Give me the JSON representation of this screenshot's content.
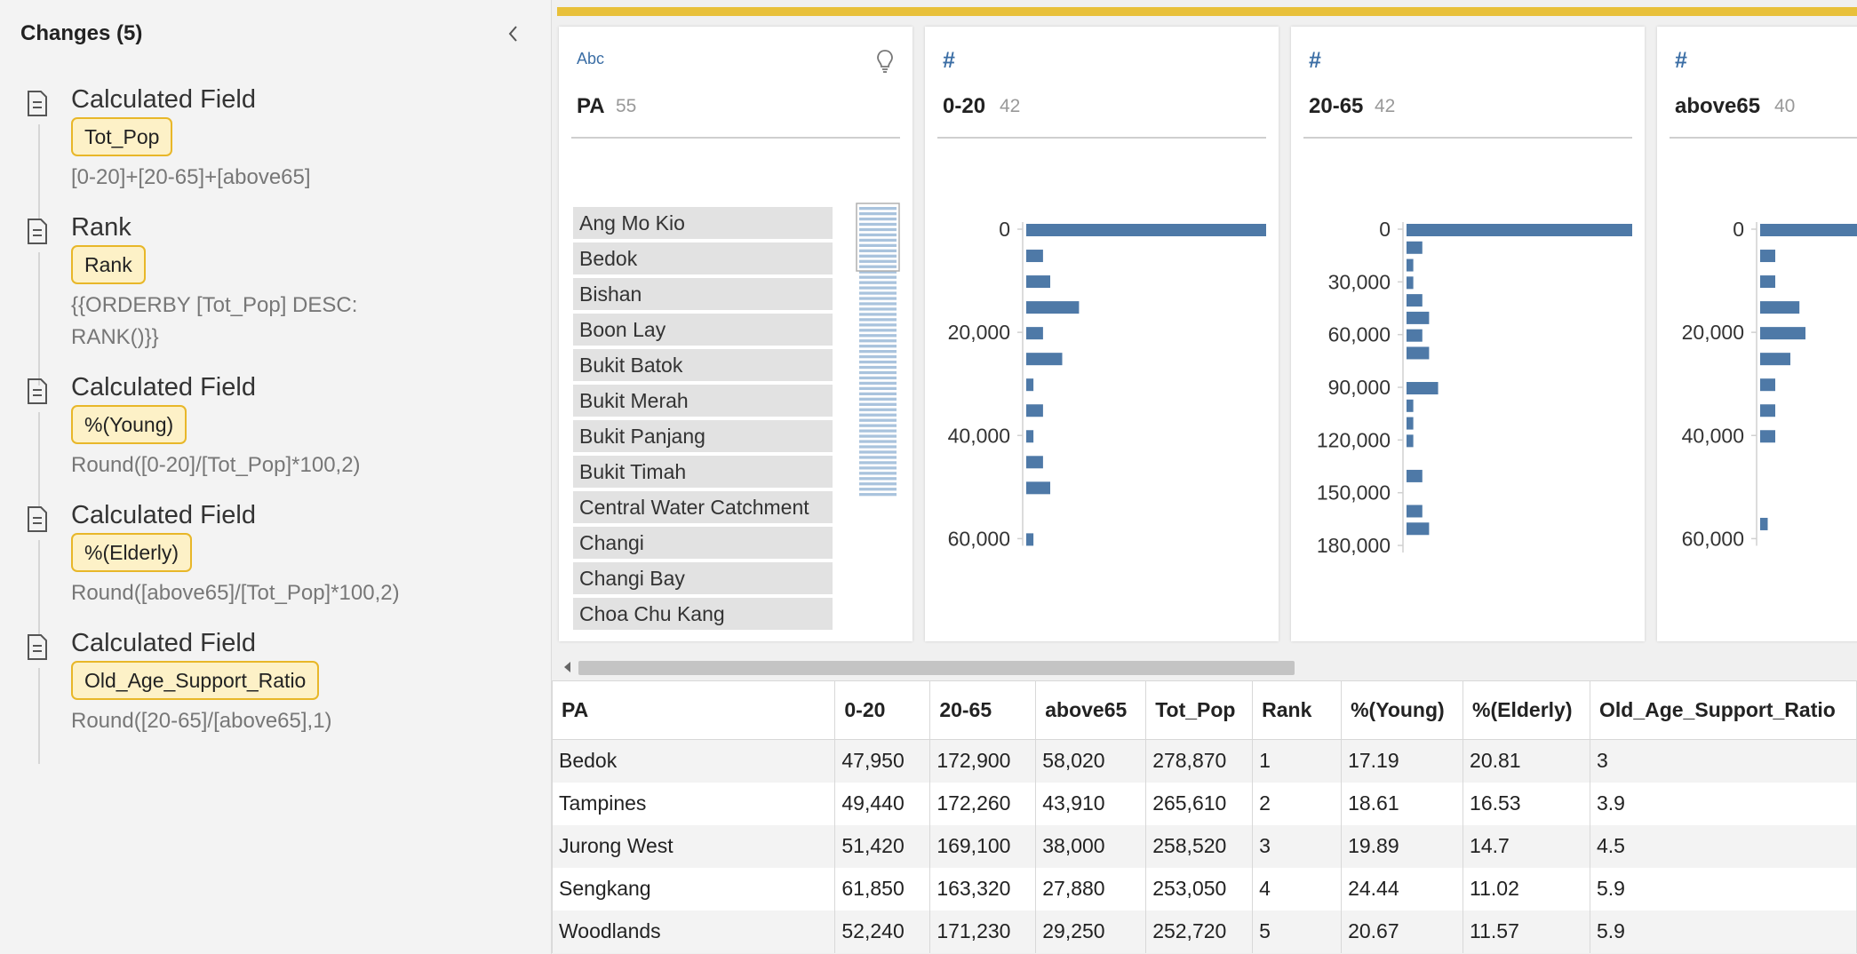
{
  "changes_panel": {
    "title": "Changes (5)",
    "items": [
      {
        "type": "Calculated Field",
        "field": "Tot_Pop",
        "formula": "[0-20]+[20-65]+[above65]"
      },
      {
        "type": "Rank",
        "field": "Rank",
        "formula": "{{ORDERBY [Tot_Pop] DESC:\nRANK()}}"
      },
      {
        "type": "Calculated Field",
        "field": "%(Young)",
        "formula": "Round([0-20]/[Tot_Pop]*100,2)"
      },
      {
        "type": "Calculated Field",
        "field": "%(Elderly)",
        "formula": "Round([above65]/[Tot_Pop]*100,2)"
      },
      {
        "type": "Calculated Field",
        "field": "Old_Age_Support_Ratio",
        "formula": "Round([20-65]/[above65],1)"
      }
    ]
  },
  "profile_cards": [
    {
      "type_label": "Abc",
      "name": "PA",
      "count": "55",
      "values": [
        "Ang Mo Kio",
        "Bedok",
        "Bishan",
        "Boon Lay",
        "Bukit Batok",
        "Bukit Merah",
        "Bukit Panjang",
        "Bukit Timah",
        "Central Water Catchment",
        "Changi",
        "Changi Bay",
        "Choa Chu Kang"
      ]
    },
    {
      "type_label": "#",
      "name": "0-20",
      "count": "42",
      "chart_data": {
        "type": "bar",
        "ticks": [
          "0",
          "20,000",
          "40,000",
          "60,000"
        ],
        "tick_values": [
          0,
          20000,
          40000,
          60000
        ],
        "ylim": [
          0,
          62000
        ],
        "bins": [
          {
            "start": 0,
            "count": 100
          },
          {
            "start": 5000,
            "count": 7
          },
          {
            "start": 10000,
            "count": 10
          },
          {
            "start": 15000,
            "count": 22
          },
          {
            "start": 20000,
            "count": 7
          },
          {
            "start": 25000,
            "count": 15
          },
          {
            "start": 30000,
            "count": 3
          },
          {
            "start": 35000,
            "count": 7
          },
          {
            "start": 40000,
            "count": 3
          },
          {
            "start": 45000,
            "count": 7
          },
          {
            "start": 50000,
            "count": 10
          },
          {
            "start": 60000,
            "count": 3
          }
        ]
      }
    },
    {
      "type_label": "#",
      "name": "20-65",
      "count": "42",
      "chart_data": {
        "type": "bar",
        "ticks": [
          "0",
          "30,000",
          "60,000",
          "90,000",
          "120,000",
          "150,000",
          "180,000"
        ],
        "tick_values": [
          0,
          30000,
          60000,
          90000,
          120000,
          150000,
          180000
        ],
        "ylim": [
          0,
          182000
        ],
        "bins": [
          {
            "start": 0,
            "count": 100
          },
          {
            "start": 10000,
            "count": 7
          },
          {
            "start": 20000,
            "count": 3
          },
          {
            "start": 30000,
            "count": 3
          },
          {
            "start": 40000,
            "count": 7
          },
          {
            "start": 50000,
            "count": 10
          },
          {
            "start": 60000,
            "count": 7
          },
          {
            "start": 70000,
            "count": 10
          },
          {
            "start": 90000,
            "count": 14
          },
          {
            "start": 100000,
            "count": 3
          },
          {
            "start": 110000,
            "count": 3
          },
          {
            "start": 120000,
            "count": 3
          },
          {
            "start": 140000,
            "count": 7
          },
          {
            "start": 160000,
            "count": 7
          },
          {
            "start": 170000,
            "count": 10
          }
        ]
      }
    },
    {
      "type_label": "#",
      "name": "above65",
      "count": "40",
      "chart_data": {
        "type": "bar",
        "ticks": [
          "0",
          "20,000",
          "40,000",
          "60,000"
        ],
        "tick_values": [
          0,
          20000,
          40000,
          60000
        ],
        "ylim": [
          0,
          62000
        ],
        "bins": [
          {
            "start": 0,
            "count": 100
          },
          {
            "start": 5000,
            "count": 10
          },
          {
            "start": 10000,
            "count": 10
          },
          {
            "start": 15000,
            "count": 26
          },
          {
            "start": 20000,
            "count": 30
          },
          {
            "start": 25000,
            "count": 20
          },
          {
            "start": 30000,
            "count": 10
          },
          {
            "start": 35000,
            "count": 10
          },
          {
            "start": 40000,
            "count": 10
          },
          {
            "start": 57000,
            "count": 5
          }
        ]
      }
    }
  ],
  "table": {
    "columns": [
      "PA",
      "0-20",
      "20-65",
      "above65",
      "Tot_Pop",
      "Rank",
      "%(Young)",
      "%(Elderly)",
      "Old_Age_Support_Ratio"
    ],
    "rows": [
      [
        "Bedok",
        "47,950",
        "172,900",
        "58,020",
        "278,870",
        "1",
        "17.19",
        "20.81",
        "3"
      ],
      [
        "Tampines",
        "49,440",
        "172,260",
        "43,910",
        "265,610",
        "2",
        "18.61",
        "16.53",
        "3.9"
      ],
      [
        "Jurong West",
        "51,420",
        "169,100",
        "38,000",
        "258,520",
        "3",
        "19.89",
        "14.7",
        "4.5"
      ],
      [
        "Sengkang",
        "61,850",
        "163,320",
        "27,880",
        "253,050",
        "4",
        "24.44",
        "11.02",
        "5.9"
      ],
      [
        "Woodlands",
        "52,240",
        "171,230",
        "29,250",
        "252,720",
        "5",
        "20.67",
        "11.57",
        "5.9"
      ]
    ]
  },
  "colors": {
    "accent": "#e8c03a",
    "pill_border": "#e8b729",
    "pill_fill": "#fdf1c7",
    "bar": "#4e79a7",
    "type_icon": "#3b6ea5"
  },
  "icons": {
    "change": "document-icon",
    "collapse": "chevron-left-icon",
    "recommendation": "lightbulb-icon",
    "numeric": "hash-icon",
    "scroll_left": "arrow-left-icon"
  }
}
